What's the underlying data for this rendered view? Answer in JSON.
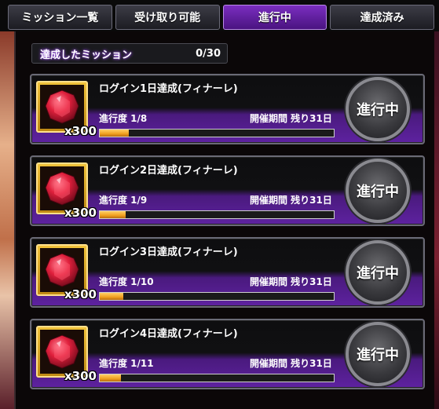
{
  "tabs": [
    {
      "label": "ミッション一覧",
      "active": false
    },
    {
      "label": "受け取り可能",
      "active": false
    },
    {
      "label": "進行中",
      "active": true
    },
    {
      "label": "達成済み",
      "active": false
    }
  ],
  "summary": {
    "label": "達成したミッション",
    "value": "0/30"
  },
  "missions": [
    {
      "title": "ログイン1日達成(フィナーレ)",
      "progress_text": "進行度 1/8",
      "progress": 0.125,
      "period": "開催期間 残り31日",
      "reward_icon": "red-gem-icon",
      "reward_qty": "x300",
      "status": "進行中"
    },
    {
      "title": "ログイン2日達成(フィナーレ)",
      "progress_text": "進行度 1/9",
      "progress": 0.111,
      "period": "開催期間 残り31日",
      "reward_icon": "red-gem-icon",
      "reward_qty": "x300",
      "status": "進行中"
    },
    {
      "title": "ログイン3日達成(フィナーレ)",
      "progress_text": "進行度 1/10",
      "progress": 0.1,
      "period": "開催期間 残り31日",
      "reward_icon": "red-gem-icon",
      "reward_qty": "x300",
      "status": "進行中"
    },
    {
      "title": "ログイン4日達成(フィナーレ)",
      "progress_text": "進行度 1/11",
      "progress": 0.091,
      "period": "開催期間 残り31日",
      "reward_icon": "red-gem-icon",
      "reward_qty": "x300",
      "status": "進行中"
    }
  ],
  "colors": {
    "accent_purple": "#5e22a0",
    "active_tab": "#7a2ec0",
    "progress_fill": "#f0a020",
    "reward_frame": "#f0c23a",
    "gem": "#d8203a"
  }
}
